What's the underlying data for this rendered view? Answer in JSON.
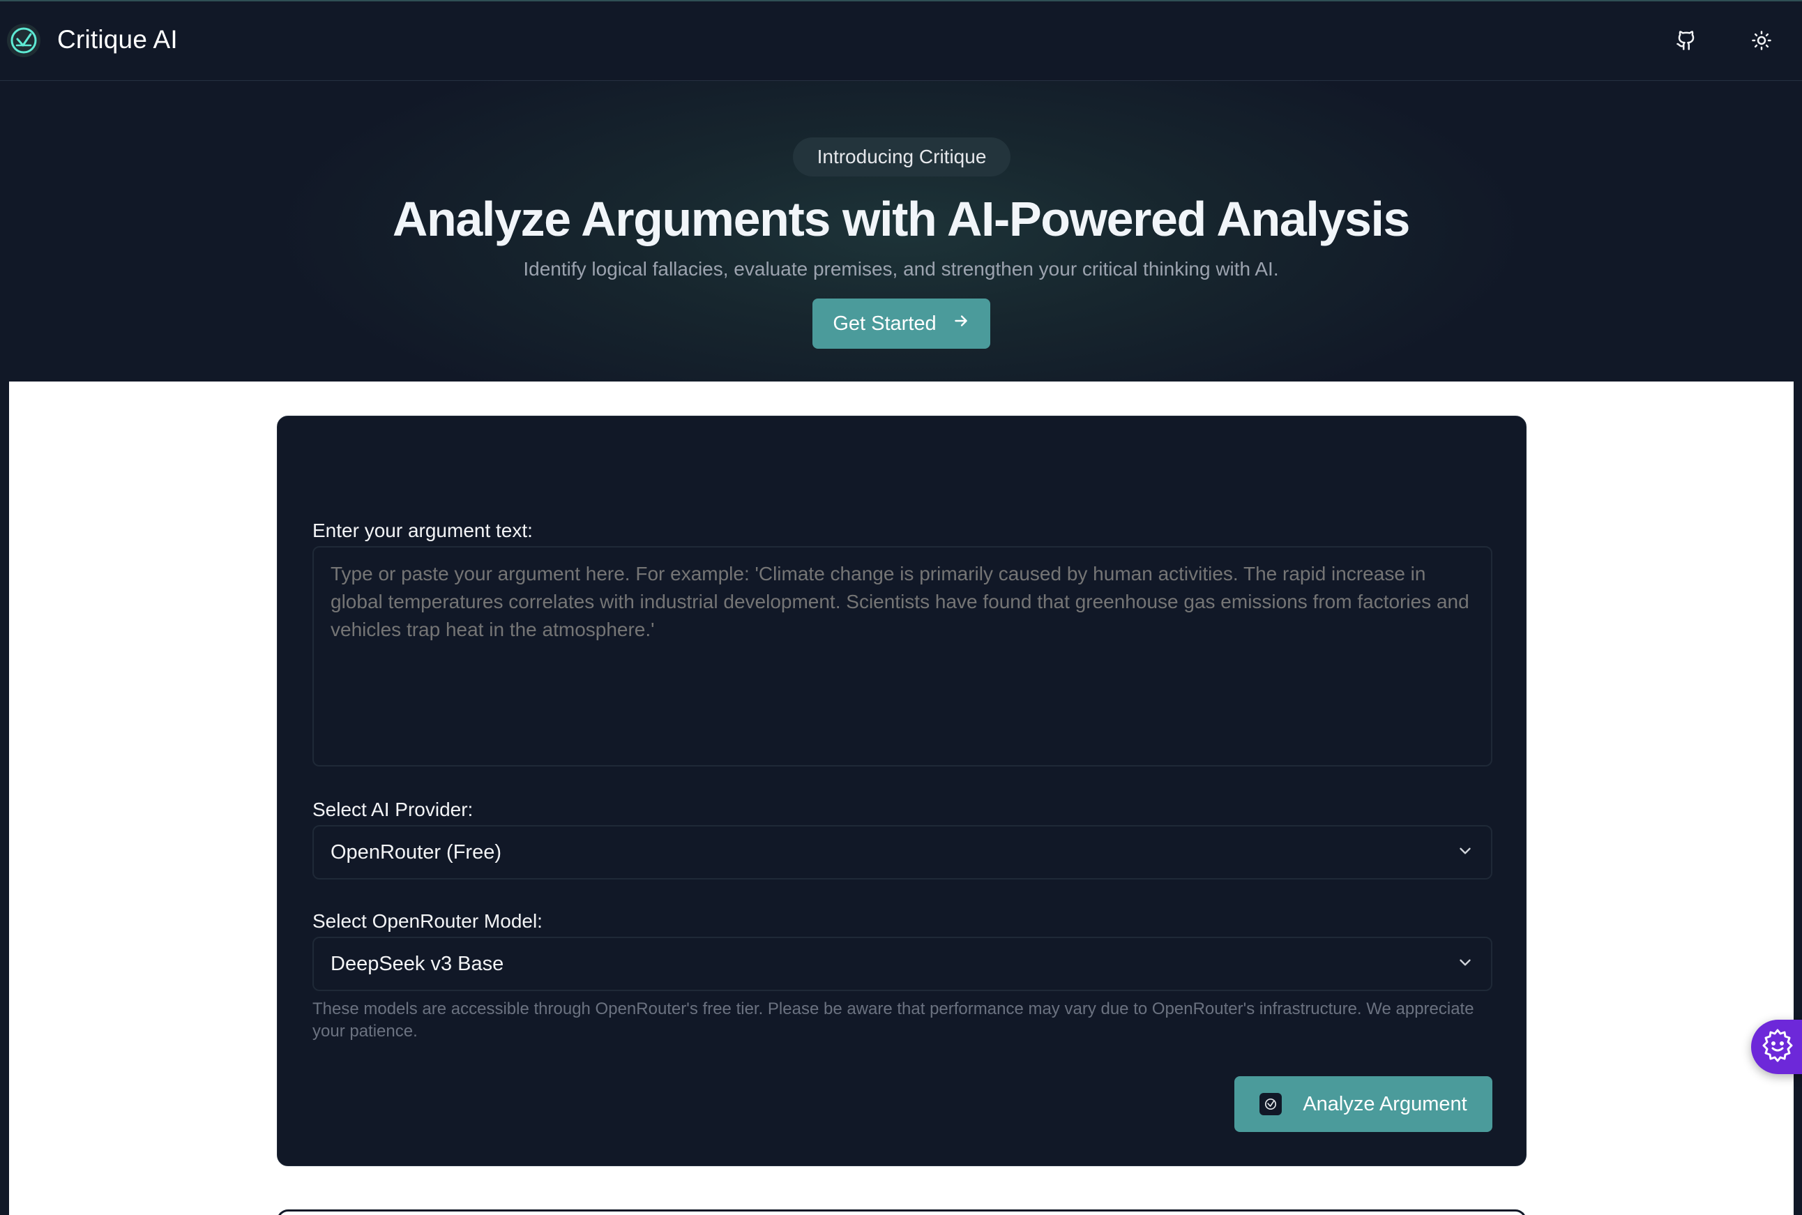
{
  "header": {
    "brand": "Critique AI",
    "icons": [
      "logo-icon",
      "github-icon",
      "sun-icon"
    ]
  },
  "hero": {
    "pill": "Introducing Critique",
    "title": "Analyze Arguments with AI-Powered Analysis",
    "subtitle": "Identify logical fallacies, evaluate premises, and strengthen your critical thinking with AI.",
    "cta_label": "Get Started"
  },
  "form": {
    "argument_label": "Enter your argument text:",
    "argument_placeholder": "Type or paste your argument here. For example: 'Climate change is primarily caused by human activities. The rapid increase in global temperatures correlates with industrial development. Scientists have found that greenhouse gas emissions from factories and vehicles trap heat in the atmosphere.'",
    "provider_label": "Select AI Provider:",
    "provider_value": "OpenRouter (Free)",
    "model_label": "Select OpenRouter Model:",
    "model_value": "DeepSeek v3 Base",
    "helper_text": "These models are accessible through OpenRouter's free tier. Please be aware that performance may vary due to OpenRouter's infrastructure. We appreciate your patience.",
    "analyze_label": "Analyze Argument"
  },
  "colors": {
    "accent": "#4b9b9b",
    "background_dark": "#111827",
    "widget": "#6d28d9"
  }
}
